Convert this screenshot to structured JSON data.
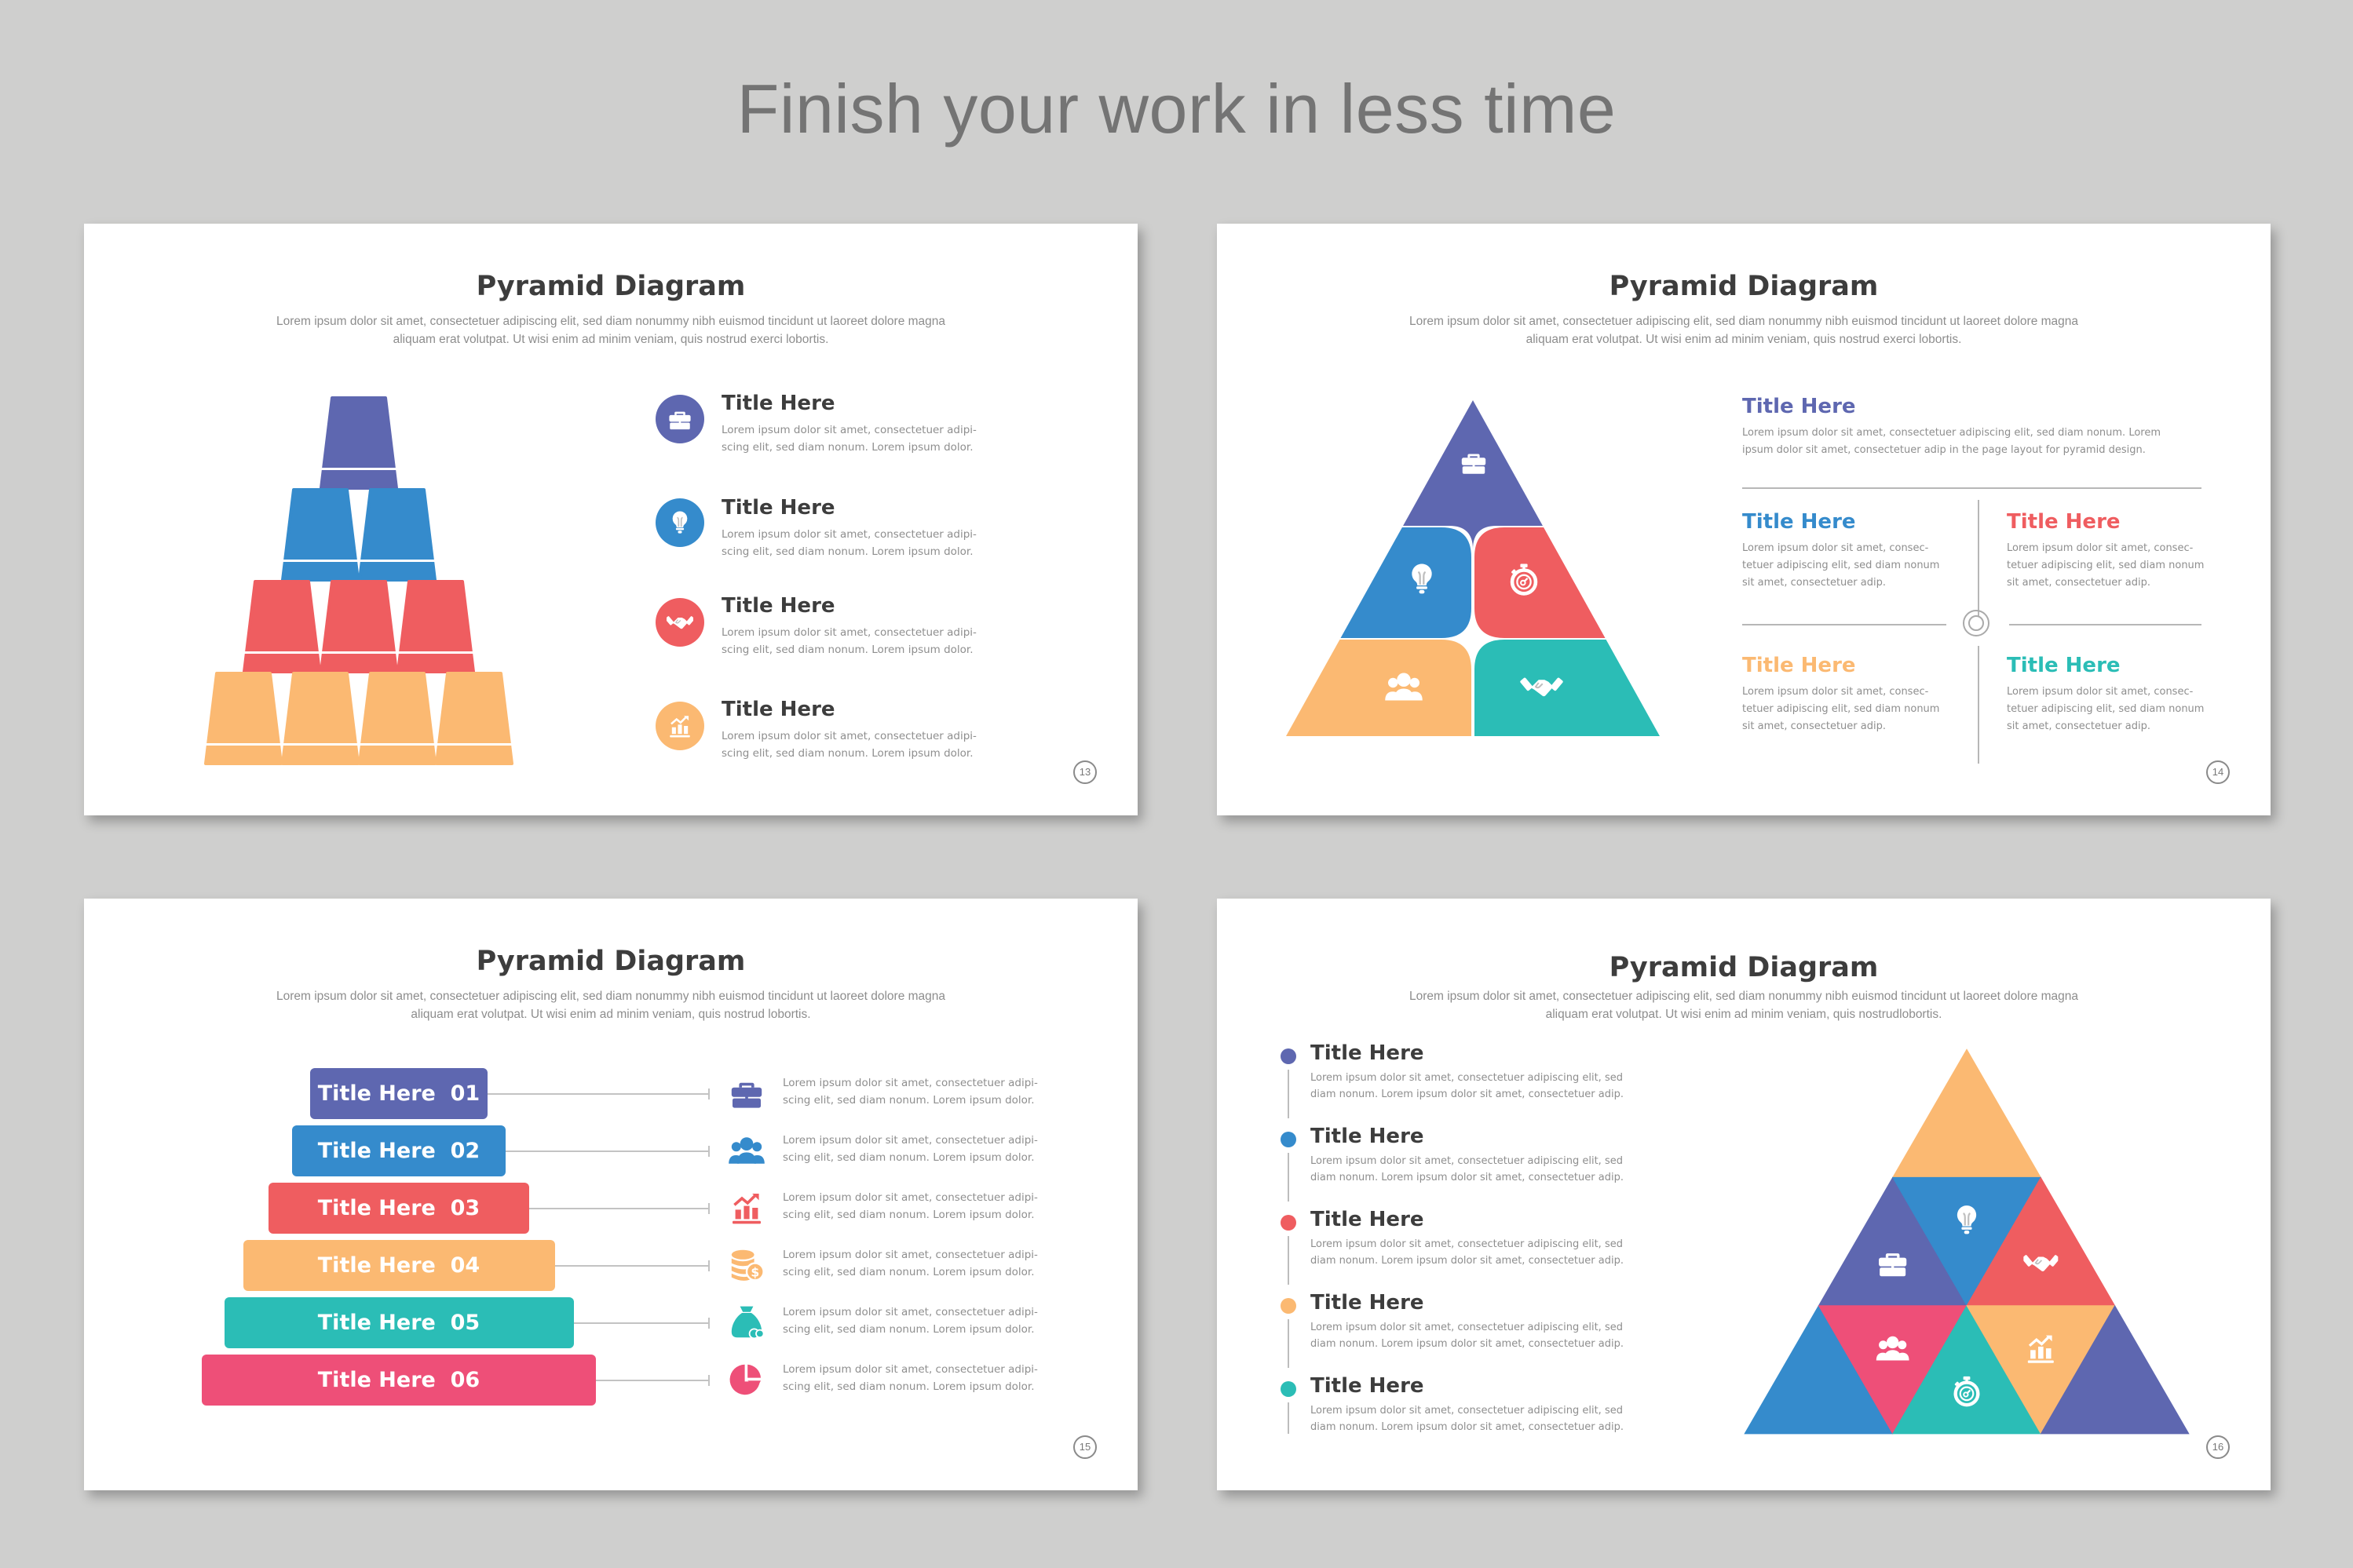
{
  "headline": "Finish your work in less time",
  "colors": {
    "purple": "#5e67b0",
    "blue": "#358bcc",
    "red": "#ef5d60",
    "orange": "#fbb972",
    "teal": "#2bbdb6",
    "pink": "#ee4f78",
    "dark_text": "#3d3d3d",
    "gray_text": "#8e8e8e",
    "background": "#cfcfce"
  },
  "slides": [
    {
      "title": "Pyramid Diagram",
      "subtitle": "Lorem ipsum dolor sit amet, consectetuer adipiscing elit, sed diam nonummy nibh euismod tincidunt ut laoreet dolore magna aliquam erat volutpat. Ut wisi enim ad minim veniam, quis nostrud exerci lobortis.",
      "page": "13",
      "cup_rows": [
        {
          "color": "purple",
          "count": 1
        },
        {
          "color": "blue",
          "count": 2
        },
        {
          "color": "red",
          "count": 3
        },
        {
          "color": "orange",
          "count": 4
        }
      ],
      "items": [
        {
          "icon": "briefcase-icon",
          "color": "purple",
          "title": "Title Here",
          "text": "Lorem ipsum dolor sit amet, consectetuer adipi-scing elit, sed diam nonum. Lorem ipsum dolor."
        },
        {
          "icon": "lightbulb-icon",
          "color": "blue",
          "title": "Title Here",
          "text": "Lorem ipsum dolor sit amet, consectetuer adipi-scing elit, sed diam nonum. Lorem ipsum dolor."
        },
        {
          "icon": "handshake-icon",
          "color": "red",
          "title": "Title Here",
          "text": "Lorem ipsum dolor sit amet, consectetuer adipi-scing elit, sed diam nonum. Lorem ipsum dolor."
        },
        {
          "icon": "growth-chart-icon",
          "color": "orange",
          "title": "Title Here",
          "text": "Lorem ipsum dolor sit amet, consectetuer adipi-scing elit, sed diam nonum. Lorem ipsum dolor."
        }
      ]
    },
    {
      "title": "Pyramid Diagram",
      "subtitle": "Lorem ipsum dolor sit amet, consectetuer adipiscing elit, sed diam nonummy nibh euismod tincidunt ut laoreet dolore magna aliquam erat volutpat. Ut wisi enim ad minim veniam, quis nostrud exerci lobortis.",
      "page": "14",
      "pyramid_segments": [
        {
          "icon": "briefcase-icon",
          "color": "purple"
        },
        {
          "icon": "lightbulb-icon",
          "color": "blue"
        },
        {
          "icon": "stopwatch-icon",
          "color": "red"
        },
        {
          "icon": "team-icon",
          "color": "orange"
        },
        {
          "icon": "handshake-icon",
          "color": "teal"
        }
      ],
      "top_item": {
        "title": "Title Here",
        "color": "purple",
        "text": "Lorem ipsum dolor sit amet, consectetuer adipiscing elit, sed diam nonum. Lorem ipsum dolor sit amet, consectetuer adip in the page layout for pyramid design."
      },
      "grid_items": [
        {
          "title": "Title Here",
          "color": "blue",
          "text": "Lorem ipsum dolor sit amet, consec-tetuer adipiscing elit, sed diam nonum sit amet, consectetuer adip."
        },
        {
          "title": "Title Here",
          "color": "red",
          "text": "Lorem ipsum dolor sit amet, consec-tetuer adipiscing elit, sed diam nonum sit amet, consectetuer adip."
        },
        {
          "title": "Title Here",
          "color": "orange",
          "text": "Lorem ipsum dolor sit amet, consec-tetuer adipiscing elit, sed diam nonum sit amet, consectetuer adip."
        },
        {
          "title": "Title Here",
          "color": "teal",
          "text": "Lorem ipsum dolor sit amet, consec-tetuer adipiscing elit, sed diam nonum sit amet, consectetuer adip."
        }
      ]
    },
    {
      "title": "Pyramid Diagram",
      "subtitle": "Lorem ipsum dolor sit amet, consectetuer adipiscing elit, sed diam nonummy nibh euismod tincidunt ut laoreet dolore magna aliquam erat volutpat. Ut wisi enim ad minim veniam, quis nostrud lobortis.",
      "page": "15",
      "levels": [
        {
          "label": "Title Here  01",
          "color": "purple",
          "icon": "briefcase-icon",
          "text": "Lorem ipsum dolor sit amet, consectetuer adipi-scing elit, sed diam nonum. Lorem ipsum dolor."
        },
        {
          "label": "Title Here  02",
          "color": "blue",
          "icon": "team-icon",
          "text": "Lorem ipsum dolor sit amet, consectetuer adipi-scing elit, sed diam nonum. Lorem ipsum dolor."
        },
        {
          "label": "Title Here  03",
          "color": "red",
          "icon": "growth-chart-icon",
          "text": "Lorem ipsum dolor sit amet, consectetuer adipi-scing elit, sed diam nonum. Lorem ipsum dolor."
        },
        {
          "label": "Title Here  04",
          "color": "orange",
          "icon": "coins-icon",
          "text": "Lorem ipsum dolor sit amet, consectetuer adipi-scing elit, sed diam nonum. Lorem ipsum dolor."
        },
        {
          "label": "Title Here  05",
          "color": "teal",
          "icon": "money-bag-icon",
          "text": "Lorem ipsum dolor sit amet, consectetuer adipi-scing elit, sed diam nonum. Lorem ipsum dolor."
        },
        {
          "label": "Title Here  06",
          "color": "pink",
          "icon": "pie-chart-icon",
          "text": "Lorem ipsum dolor sit amet, consectetuer adipi-scing elit, sed diam nonum. Lorem ipsum dolor."
        }
      ]
    },
    {
      "title": "Pyramid Diagram",
      "subtitle": "Lorem ipsum dolor sit amet, consectetuer adipiscing elit, sed diam nonummy nibh euismod tincidunt ut laoreet dolore magna aliquam erat volutpat. Ut wisi enim ad minim veniam, quis nostrudlobortis.",
      "page": "16",
      "timeline": [
        {
          "title": "Title Here",
          "color": "purple",
          "text": "Lorem ipsum dolor sit amet, consectetuer adipiscing elit, sed diam nonum. Lorem ipsum dolor sit amet, consectetuer adip."
        },
        {
          "title": "Title Here",
          "color": "blue",
          "text": "Lorem ipsum dolor sit amet, consectetuer adipiscing elit, sed diam nonum. Lorem ipsum dolor sit amet, consectetuer adip."
        },
        {
          "title": "Title Here",
          "color": "red",
          "text": "Lorem ipsum dolor sit amet, consectetuer adipiscing elit, sed diam nonum. Lorem ipsum dolor sit amet, consectetuer adip."
        },
        {
          "title": "Title Here",
          "color": "orange",
          "text": "Lorem ipsum dolor sit amet, consectetuer adipiscing elit, sed diam nonum. Lorem ipsum dolor sit amet, consectetuer adip."
        },
        {
          "title": "Title Here",
          "color": "teal",
          "text": "Lorem ipsum dolor sit amet, consectetuer adipiscing elit, sed diam nonum. Lorem ipsum dolor sit amet, consectetuer adip."
        }
      ],
      "triangles": [
        {
          "row": 0,
          "color": "orange",
          "icon": ""
        },
        {
          "row": 1,
          "color": "purple",
          "icon": "briefcase-icon"
        },
        {
          "row": 1,
          "color": "blue",
          "icon": "lightbulb-icon"
        },
        {
          "row": 1,
          "color": "red",
          "icon": "handshake-icon"
        },
        {
          "row": 2,
          "color": "blue",
          "icon": ""
        },
        {
          "row": 2,
          "color": "pink",
          "icon": "team-icon"
        },
        {
          "row": 2,
          "color": "teal",
          "icon": "stopwatch-icon"
        },
        {
          "row": 2,
          "color": "orange",
          "icon": "growth-chart-icon"
        },
        {
          "row": 2,
          "color": "purple",
          "icon": ""
        }
      ]
    }
  ]
}
